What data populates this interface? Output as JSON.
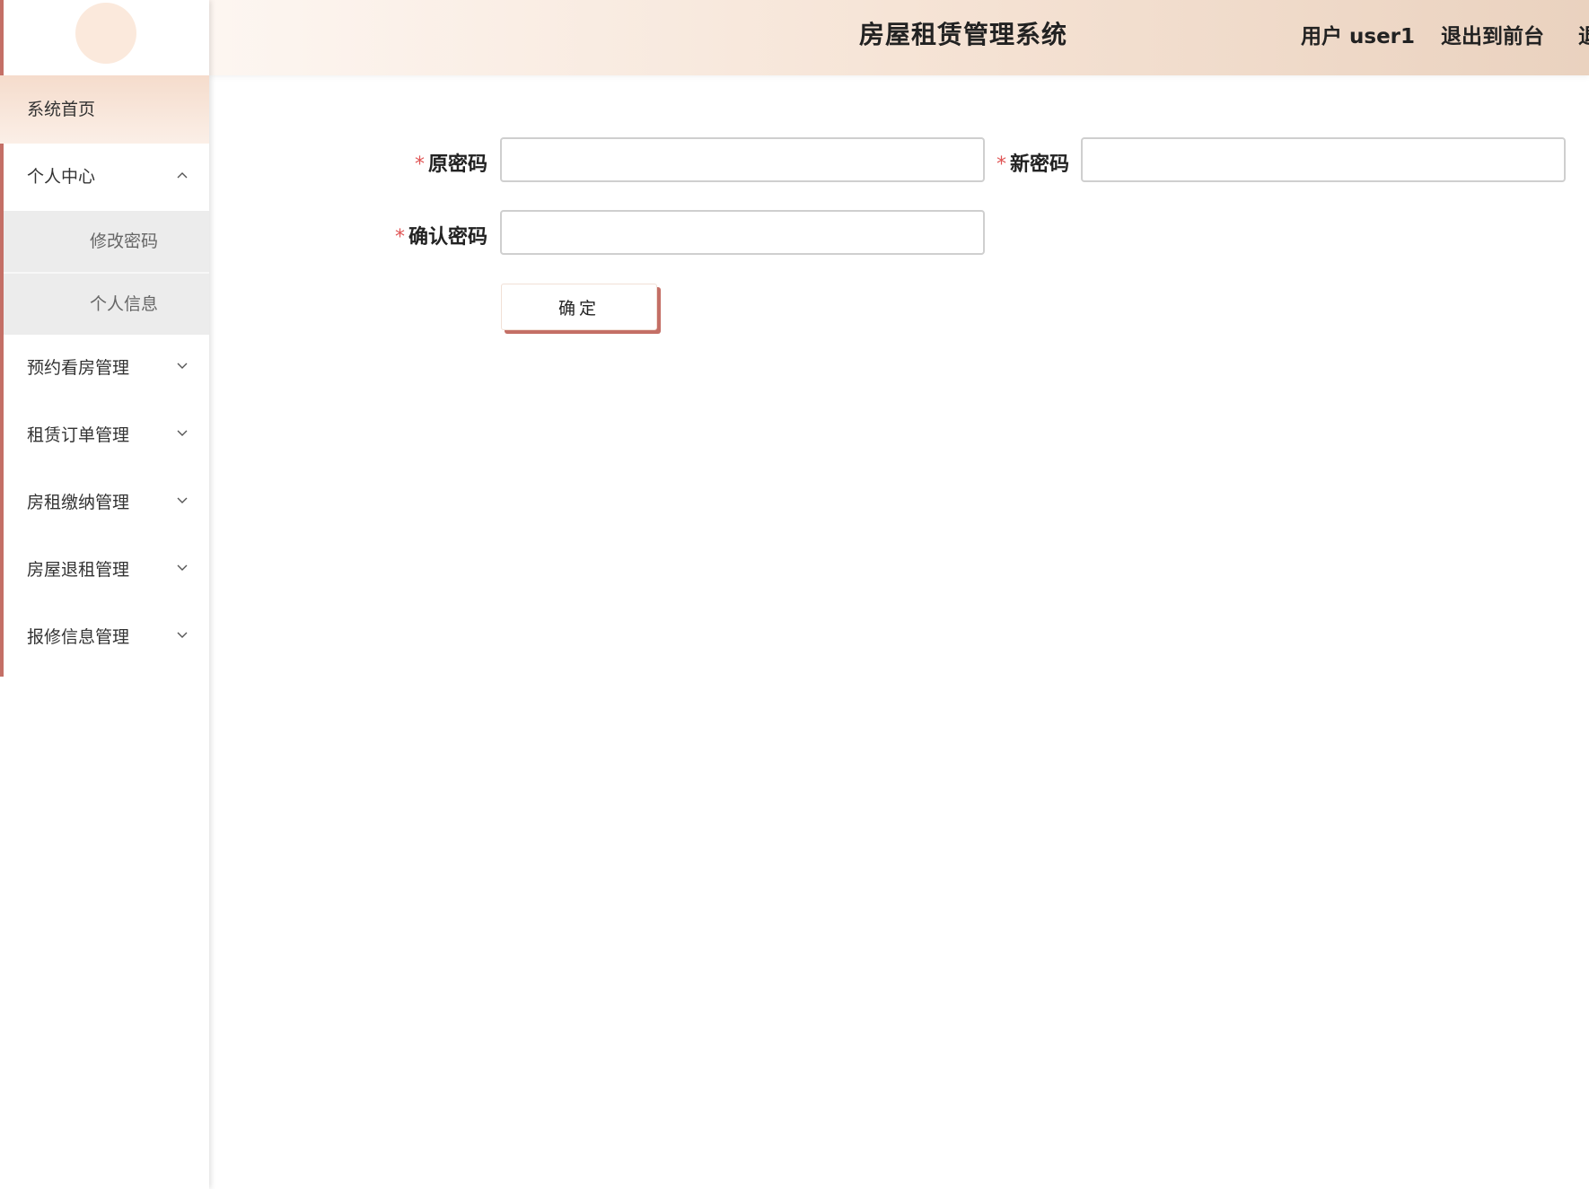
{
  "app": {
    "title": "房屋租赁管理系统"
  },
  "header": {
    "user_label": "用户 user1",
    "front_link": "退出到前台",
    "logout_link": "退"
  },
  "sidebar": {
    "items": [
      {
        "label": "系统首页"
      },
      {
        "label": "个人中心",
        "expanded": true,
        "children": [
          {
            "label": "修改密码"
          },
          {
            "label": "个人信息"
          }
        ]
      },
      {
        "label": "预约看房管理"
      },
      {
        "label": "租赁订单管理"
      },
      {
        "label": "房租缴纳管理"
      },
      {
        "label": "房屋退租管理"
      },
      {
        "label": "报修信息管理"
      }
    ]
  },
  "form": {
    "required_mark": "*",
    "old_password_label": "原密码",
    "new_password_label": "新密码",
    "confirm_password_label": "确认密码",
    "old_password_value": "",
    "new_password_value": "",
    "confirm_password_value": "",
    "submit_label": "确定"
  },
  "colors": {
    "accent": "#c46f66",
    "required": "#e05555",
    "active_menu": "#f5dccc",
    "submenu_bg": "#ececec"
  }
}
